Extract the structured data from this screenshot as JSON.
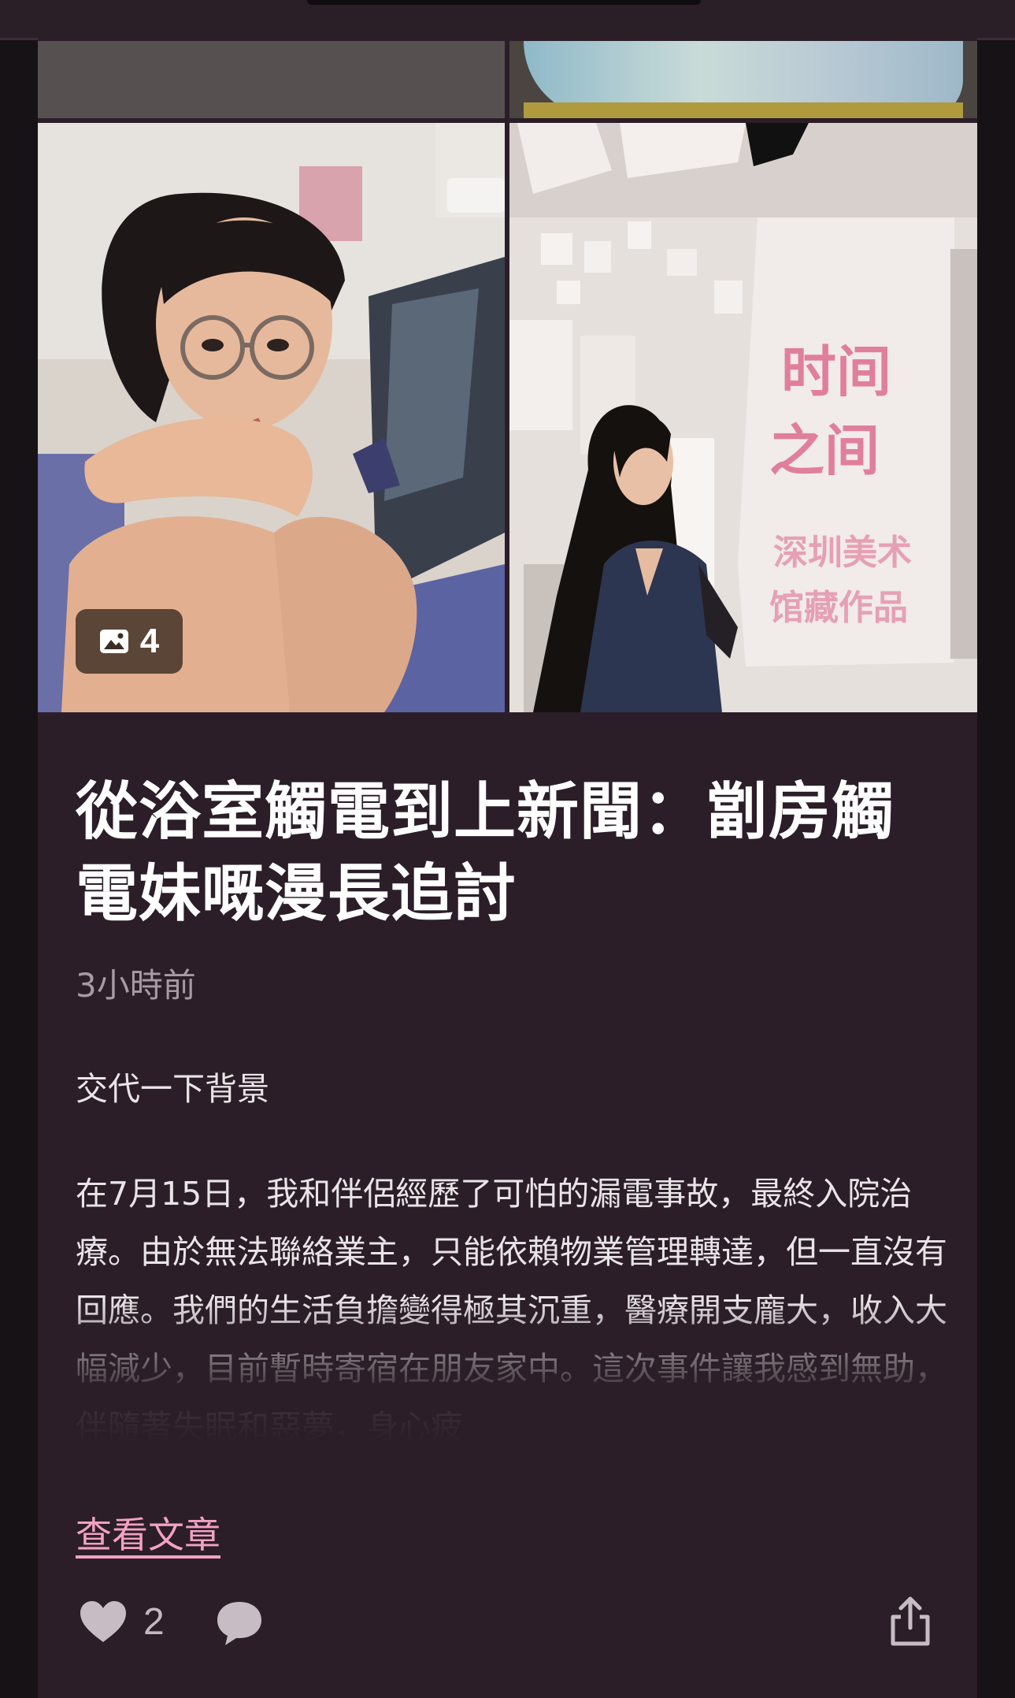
{
  "post": {
    "image_count": "4",
    "title": "從浴室觸電到上新聞：劏房觸電妹嘅漫長追討",
    "timestamp": "3小時前",
    "intro": "交代一下背景",
    "body": "在7月15日，我和伴侶經歷了可怕的漏電事故，最終入院治療。由於無法聯絡業主，只能依賴物業管理轉達，但一直沒有回應。我們的生活負擔變得極其沉重，醫療開支龐大，收入大幅減少，目前暫時寄宿在朋友家中。這次事件讓我感到無助，伴隨著失眠和惡夢，身心疲",
    "view_article": "查看文章",
    "likes": "2"
  },
  "gallery_sign": {
    "line1": "时间",
    "line2": "之间",
    "line3": "深圳美术",
    "line4": "馆藏作品"
  },
  "icons": {
    "image_count": "image-icon",
    "like": "heart-icon",
    "comment": "speech-bubble-icon",
    "share": "share-icon"
  },
  "colors": {
    "background": "#171215",
    "card": "#2b1e28",
    "title": "#ffffff",
    "link": "#f2a1c4",
    "muted": "#a89aa5"
  }
}
